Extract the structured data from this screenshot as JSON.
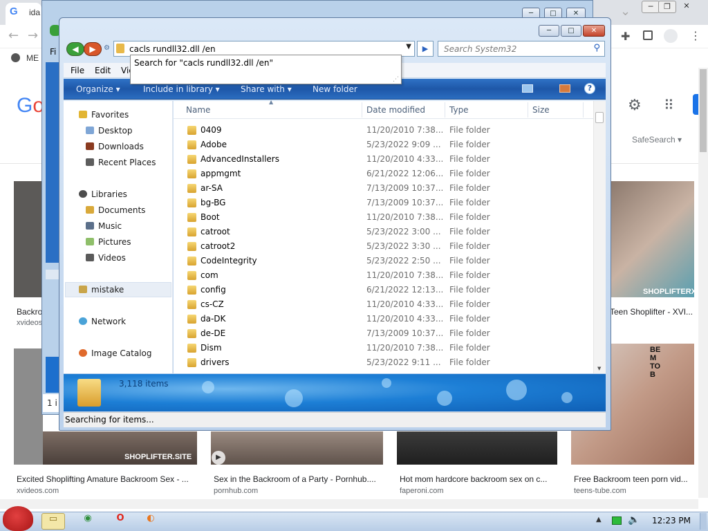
{
  "browser": {
    "tab_title": "ida",
    "bookmark_label": "ME",
    "google_logo": "Go",
    "safesearch": "SafeSearch ▾",
    "results": [
      {
        "caption": "Backro",
        "source": "xvideos"
      },
      {
        "caption": "Teen Shoplifter - XVI...",
        "source": "",
        "badge": "SHOPLIFTERX"
      },
      {
        "caption": "Excited Shoplifting Amature Backroom Sex - ...",
        "source": "xvideos.com",
        "badge": "SHOPLIFTER.SITE"
      },
      {
        "caption": "Sex in the Backroom of a Party - Pornhub....",
        "source": "pornhub.com"
      },
      {
        "caption": "Hot mom hardcore backroom sex on c...",
        "source": "faperoni.com"
      },
      {
        "caption": "Free Backroom teen porn vid...",
        "source": "teens-tube.com"
      }
    ],
    "thumb_text": "BE M TO B"
  },
  "behind_window": {
    "status_text": "1 i",
    "menu_hint": "Fi"
  },
  "explorer": {
    "address_value": "cacls rundll32.dll /en",
    "search_placeholder": "Search System32",
    "suggestion": "Search for \"cacls rundll32.dll /en\"",
    "menu": [
      "File",
      "Edit",
      "Vie"
    ],
    "commands": {
      "organize": "Organize ▾",
      "include": "Include in library ▾",
      "share": "Share with ▾",
      "new_folder": "New folder"
    },
    "nav": {
      "favorites": "Favorites",
      "desktop": "Desktop",
      "downloads": "Downloads",
      "recent": "Recent Places",
      "libraries": "Libraries",
      "documents": "Documents",
      "music": "Music",
      "pictures": "Pictures",
      "videos": "Videos",
      "mistake": "mistake",
      "network": "Network",
      "image_catalog": "Image Catalog"
    },
    "columns": {
      "name": "Name",
      "date": "Date modified",
      "type": "Type",
      "size": "Size"
    },
    "files": [
      {
        "name": "0409",
        "date": "11/20/2010 7:38...",
        "type": "File folder"
      },
      {
        "name": "Adobe",
        "date": "5/23/2022 9:09 ...",
        "type": "File folder"
      },
      {
        "name": "AdvancedInstallers",
        "date": "11/20/2010 4:33...",
        "type": "File folder"
      },
      {
        "name": "appmgmt",
        "date": "6/21/2022 12:06...",
        "type": "File folder"
      },
      {
        "name": "ar-SA",
        "date": "7/13/2009 10:37...",
        "type": "File folder"
      },
      {
        "name": "bg-BG",
        "date": "7/13/2009 10:37...",
        "type": "File folder"
      },
      {
        "name": "Boot",
        "date": "11/20/2010 7:38...",
        "type": "File folder"
      },
      {
        "name": "catroot",
        "date": "5/23/2022 3:00 ...",
        "type": "File folder"
      },
      {
        "name": "catroot2",
        "date": "5/23/2022 3:30 ...",
        "type": "File folder"
      },
      {
        "name": "CodeIntegrity",
        "date": "5/23/2022 2:50 ...",
        "type": "File folder"
      },
      {
        "name": "com",
        "date": "11/20/2010 7:38...",
        "type": "File folder"
      },
      {
        "name": "config",
        "date": "6/21/2022 12:13...",
        "type": "File folder"
      },
      {
        "name": "cs-CZ",
        "date": "11/20/2010 4:33...",
        "type": "File folder"
      },
      {
        "name": "da-DK",
        "date": "11/20/2010 4:33...",
        "type": "File folder"
      },
      {
        "name": "de-DE",
        "date": "7/13/2009 10:37...",
        "type": "File folder"
      },
      {
        "name": "Dism",
        "date": "11/20/2010 7:38...",
        "type": "File folder"
      },
      {
        "name": "drivers",
        "date": "5/23/2022 9:11 ...",
        "type": "File folder"
      }
    ],
    "item_count": "3,118 items",
    "status": "Searching for items..."
  },
  "taskbar": {
    "time": "12:23 PM"
  },
  "colors": {
    "cmdbar": "#1e57a8",
    "details": "#1d7fd6",
    "folder": "#e8b94a"
  },
  "icons": [
    "search-icon",
    "folder-icon",
    "star-icon",
    "speaker-icon",
    "network-icon"
  ]
}
